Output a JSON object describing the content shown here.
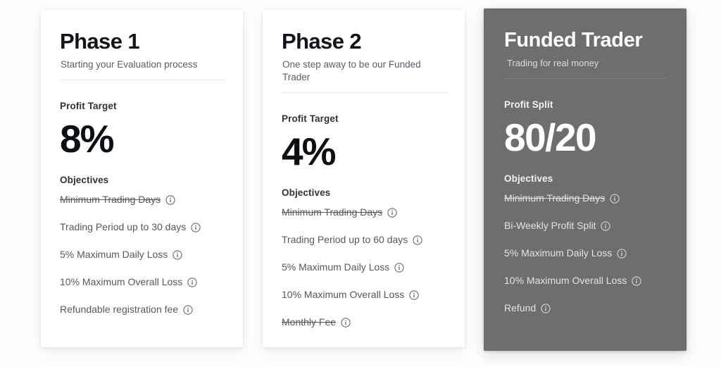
{
  "page": {
    "background_color": "#fdfdfd"
  },
  "cards": [
    {
      "title": "Phase 1",
      "subtitle": "Starting your Evaluation process",
      "metric_label": "Profit Target",
      "metric_value": "8%",
      "objectives_label": "Objectives",
      "theme": "light",
      "background_color": "#ffffff",
      "objectives": [
        {
          "text": "Minimum Trading Days",
          "struck": true,
          "icon": "info-icon"
        },
        {
          "text": "Trading Period up to 30 days",
          "struck": false,
          "icon": "info-icon"
        },
        {
          "text": "5% Maximum Daily Loss",
          "struck": false,
          "icon": "info-icon"
        },
        {
          "text": "10% Maximum Overall Loss",
          "struck": false,
          "icon": "info-icon"
        },
        {
          "text": "Refundable registration fee",
          "struck": false,
          "icon": "info-icon"
        }
      ]
    },
    {
      "title": "Phase 2",
      "subtitle": "One step away to be our Funded Trader",
      "metric_label": "Profit Target",
      "metric_value": "4%",
      "objectives_label": "Objectives",
      "theme": "light",
      "background_color": "#ffffff",
      "objectives": [
        {
          "text": "Minimum Trading Days",
          "struck": true,
          "icon": "info-icon"
        },
        {
          "text": "Trading Period up to 60 days",
          "struck": false,
          "icon": "info-icon"
        },
        {
          "text": "5% Maximum Daily Loss",
          "struck": false,
          "icon": "info-icon"
        },
        {
          "text": "10% Maximum Overall Loss",
          "struck": false,
          "icon": "info-icon"
        },
        {
          "text": "Monthly Fee",
          "struck": true,
          "icon": "info-icon"
        }
      ]
    },
    {
      "title": "Funded Trader",
      "subtitle": "Trading for real money",
      "metric_label": "Profit Split",
      "metric_value": "80/20",
      "objectives_label": "Objectives",
      "theme": "dark",
      "background_color": "#6e6e6e",
      "objectives": [
        {
          "text": "Minimum Trading Days",
          "struck": true,
          "icon": "info-icon"
        },
        {
          "text": "Bi-Weekly Profit Split",
          "struck": false,
          "icon": "info-icon"
        },
        {
          "text": "5% Maximum Daily Loss",
          "struck": false,
          "icon": "info-icon"
        },
        {
          "text": "10% Maximum Overall Loss",
          "struck": false,
          "icon": "info-icon"
        },
        {
          "text": "Refund",
          "struck": false,
          "icon": "info-icon"
        }
      ]
    }
  ]
}
